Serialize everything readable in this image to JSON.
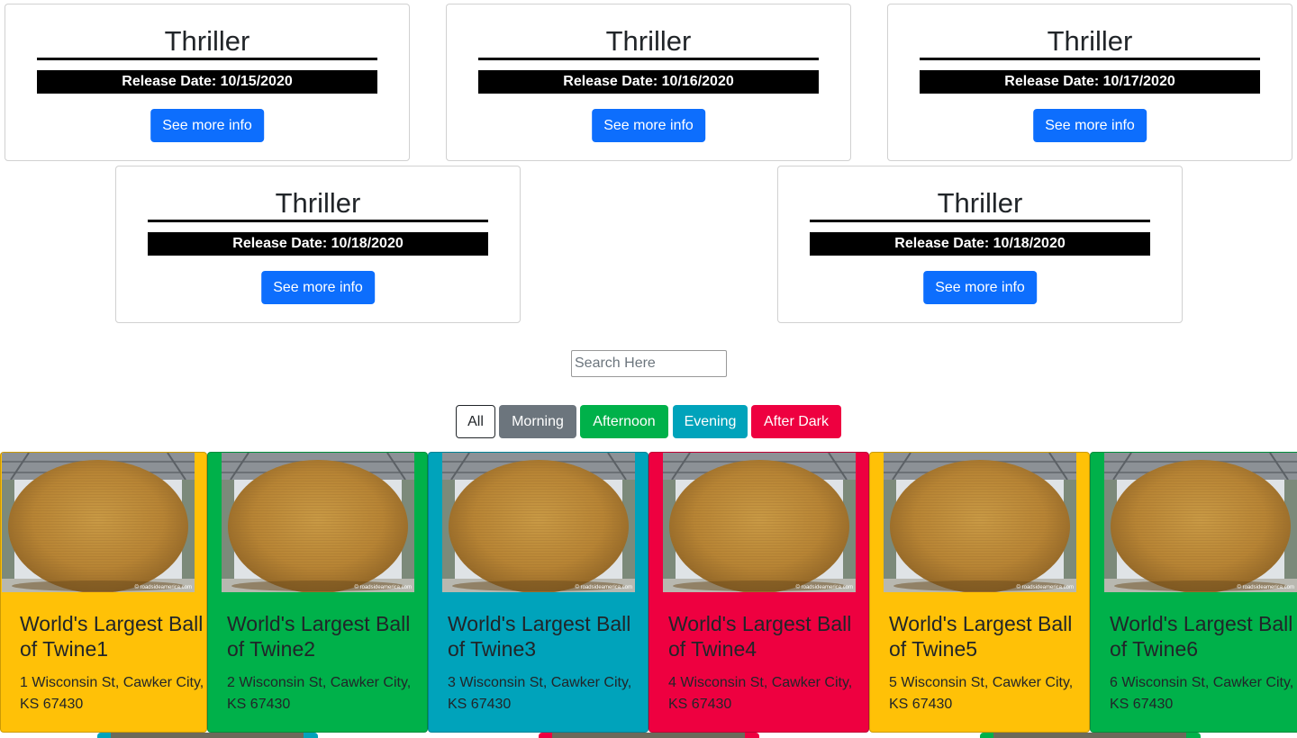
{
  "movies": [
    {
      "title": "Thriller",
      "release": "Release Date: 10/15/2020",
      "button": "See more info"
    },
    {
      "title": "Thriller",
      "release": "Release Date: 10/16/2020",
      "button": "See more info"
    },
    {
      "title": "Thriller",
      "release": "Release Date: 10/17/2020",
      "button": "See more info"
    },
    {
      "title": "Thriller",
      "release": "Release Date: 10/18/2020",
      "button": "See more info"
    },
    {
      "title": "Thriller",
      "release": "Release Date: 10/18/2020",
      "button": "See more info"
    }
  ],
  "search": {
    "placeholder": "Search Here",
    "value": ""
  },
  "filters": [
    {
      "label": "All",
      "color": "#ffffff"
    },
    {
      "label": "Morning",
      "color": "#6c757d"
    },
    {
      "label": "Afternoon",
      "color": "#00b14a"
    },
    {
      "label": "Evening",
      "color": "#00a3bb"
    },
    {
      "label": "After Dark",
      "color": "#ee0040"
    }
  ],
  "places": [
    {
      "title": "World's Largest Ball of Twine1",
      "address": "1 Wisconsin St, Cawker City, KS 67430",
      "color": "#ffc107",
      "photo_credit": "© roadsideamerica.com"
    },
    {
      "title": "World's Largest Ball of Twine2",
      "address": "2 Wisconsin St, Cawker City, KS 67430",
      "color": "#00b14a",
      "photo_credit": "© roadsideamerica.com"
    },
    {
      "title": "World's Largest Ball of Twine3",
      "address": "3 Wisconsin St, Cawker City, KS 67430",
      "color": "#00a3bb",
      "photo_credit": "© roadsideamerica.com"
    },
    {
      "title": "World's Largest Ball of Twine4",
      "address": "4 Wisconsin St, Cawker City, KS 67430",
      "color": "#ee0040",
      "photo_credit": "© roadsideamerica.com"
    },
    {
      "title": "World's Largest Ball of Twine5",
      "address": "5 Wisconsin St, Cawker City, KS 67430",
      "color": "#ffc107",
      "photo_credit": "© roadsideamerica.com"
    },
    {
      "title": "World's Largest Ball of Twine6",
      "address": "6 Wisconsin St, Cawker City, KS 67430",
      "color": "#00b14a",
      "photo_credit": "© roadsideamerica.com"
    }
  ],
  "next_row_colors": [
    "#00a3bb",
    "#ee0040",
    "#00b14a"
  ]
}
